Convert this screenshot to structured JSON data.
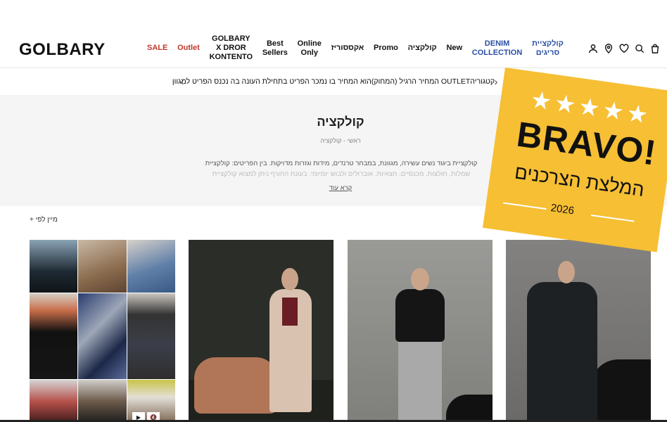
{
  "brand": {
    "logo": "GOLBARY"
  },
  "nav": {
    "items": [
      {
        "label": "SALE",
        "color": "red"
      },
      {
        "label": "Outlet",
        "color": "red"
      },
      {
        "label": "GOLBARY\nX DROR\nKONTENTO",
        "color": "default"
      },
      {
        "label": "Best\nSellers",
        "color": "default"
      },
      {
        "label": "Online\nOnly",
        "color": "default"
      },
      {
        "label": "אקססוריז",
        "color": "default"
      },
      {
        "label": "Promo",
        "color": "default"
      },
      {
        "label": "קולקציה",
        "color": "default"
      },
      {
        "label": "New",
        "color": "default"
      },
      {
        "label": "DENIM\nCOLLECTION",
        "color": "blue"
      },
      {
        "label": "קולקציית\nסריגים",
        "color": "blue"
      }
    ]
  },
  "header_icons": [
    "user-icon",
    "location-pin-icon",
    "heart-icon",
    "search-icon",
    "bag-icon"
  ],
  "announcement": {
    "text": "קטגוריהOUTLET המחיר הרגיל (המחוק)הוא המחיר בו נמכר הפריט בתחילת העונה בה נכנס הפריט למגוון"
  },
  "category": {
    "title": "קולקציה",
    "breadcrumb": "ראשי - קולקציה",
    "description_line1": "קולקציית ביגוד נשים עשירה, מגוונת, במבחר טרנדים, מידות וגזרות מדויקות. בין הפריטים: קולקציית",
    "description_line2": "שמלות, חולצות, מכנסיים, חצאיות, אוברולים ולבוש יומיומי. בעונת החורף ניתן למצוא קולקציית",
    "read_more": "קרא עוד"
  },
  "sort": {
    "label": "מיין לפי +"
  },
  "badge": {
    "stars": "★★★★★",
    "title": "BRAVO!",
    "subtitle": "המלצת הצרכנים",
    "year": "2026"
  },
  "colors": {
    "sale_red": "#c0392b",
    "denim_blue": "#2a4fa3",
    "badge_yellow": "#f6bf34",
    "hero_bg": "#f5f5f5"
  }
}
